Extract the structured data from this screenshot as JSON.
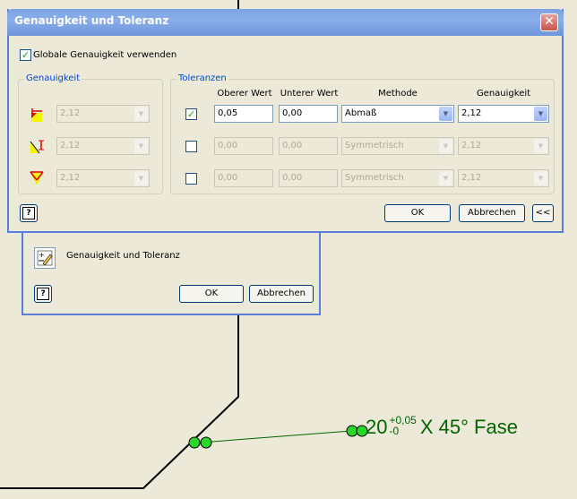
{
  "drawing": {
    "dimension_main": "20",
    "tolerance_upper": "+0,05",
    "tolerance_lower": "-0",
    "dimension_suffix": "X 45° Fase",
    "accent_color": "#006400"
  },
  "back_dialog": {
    "label": "Genauigkeit und Toleranz",
    "ok": "OK",
    "cancel": "Abbrechen"
  },
  "dialog": {
    "title": "Genauigkeit und Toleranz",
    "global_checkbox_label": "Globale Genauigkeit verwenden",
    "global_checked": true,
    "precision_group": {
      "title": "Genauigkeit",
      "rows": [
        {
          "icon": "linear-dimension-icon",
          "value": "2,12"
        },
        {
          "icon": "angular-dimension-icon",
          "value": "2,12"
        },
        {
          "icon": "radial-dimension-icon",
          "value": "2,12"
        }
      ]
    },
    "tolerance_group": {
      "title": "Toleranzen",
      "headers": {
        "upper": "Oberer Wert",
        "lower": "Unterer Wert",
        "method": "Methode",
        "precision": "Genauigkeit"
      },
      "rows": [
        {
          "checked": true,
          "upper": "0,05",
          "lower": "0,00",
          "method": "Abmaß",
          "precision": "2,12"
        },
        {
          "checked": false,
          "upper": "0,00",
          "lower": "0,00",
          "method": "Symmetrisch",
          "precision": "2,12"
        },
        {
          "checked": false,
          "upper": "0,00",
          "lower": "0,00",
          "method": "Symmetrisch",
          "precision": "2,12"
        }
      ]
    },
    "ok": "OK",
    "cancel": "Abbrechen",
    "collapse": "<<",
    "help": "?"
  }
}
